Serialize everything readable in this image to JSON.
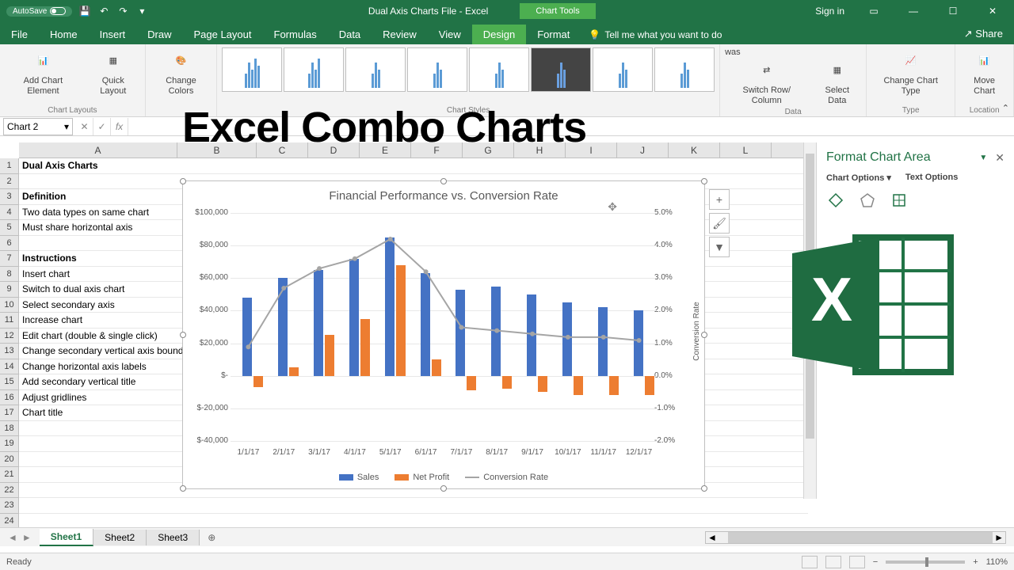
{
  "titlebar": {
    "autosave": "AutoSave",
    "filename": "Dual Axis Charts File - Excel",
    "chart_tools": "Chart Tools",
    "signin": "Sign in"
  },
  "tabs": {
    "file": "File",
    "home": "Home",
    "insert": "Insert",
    "draw": "Draw",
    "page_layout": "Page Layout",
    "formulas": "Formulas",
    "data": "Data",
    "review": "Review",
    "view": "View",
    "design": "Design",
    "format": "Format",
    "tell_me": "Tell me what you want to do",
    "share": "Share"
  },
  "ribbon": {
    "add_chart_element": "Add Chart Element",
    "quick_layout": "Quick Layout",
    "change_colors": "Change Colors",
    "chart_layouts": "Chart Layouts",
    "chart_styles": "Chart Styles",
    "switch_row_col": "Switch Row/ Column",
    "select_data": "Select Data",
    "data_group": "Data",
    "change_chart_type": "Change Chart Type",
    "type_group": "Type",
    "move_chart": "Move Chart",
    "location_group": "Location"
  },
  "overlay_title": "Excel Combo Charts",
  "name_box": "Chart 2",
  "columns": [
    "A",
    "B",
    "C",
    "D",
    "E",
    "F",
    "G",
    "H",
    "I",
    "J",
    "K",
    "L"
  ],
  "rows": [
    "1",
    "2",
    "3",
    "4",
    "5",
    "6",
    "7",
    "8",
    "9",
    "10",
    "11",
    "12",
    "13",
    "14",
    "15",
    "16",
    "17",
    "18",
    "19",
    "20",
    "21",
    "22",
    "23",
    "24"
  ],
  "cells": {
    "r1": "Dual Axis Charts",
    "r3": "Definition",
    "r4": "Two data types on same chart",
    "r5": "Must share horizontal axis",
    "r7": "Instructions",
    "r8": "Insert chart",
    "r9": "Switch to dual axis chart",
    "r10": "Select secondary axis",
    "r11": "Increase chart",
    "r12": "Edit chart (double & single click)",
    "r13": "Change secondary vertical axis bounds",
    "r14": "Change horizontal axis labels",
    "r15": "Add secondary vertical title",
    "r16": "Adjust gridlines",
    "r17": "Chart title"
  },
  "chart": {
    "title": "Financial Performance vs. Conversion Rate",
    "y_left": [
      "$100,000",
      "$80,000",
      "$60,000",
      "$40,000",
      "$20,000",
      "$-",
      "$-20,000",
      "$-40,000"
    ],
    "y_right": [
      "5.0%",
      "4.0%",
      "3.0%",
      "2.0%",
      "1.0%",
      "0.0%",
      "-1.0%",
      "-2.0%"
    ],
    "x": [
      "1/1/17",
      "2/1/17",
      "3/1/17",
      "4/1/17",
      "5/1/17",
      "6/1/17",
      "7/1/17",
      "8/1/17",
      "9/1/17",
      "10/1/17",
      "11/1/17",
      "12/1/17"
    ],
    "sec_title": "Conversion Rate",
    "legend": {
      "sales": "Sales",
      "profit": "Net Profit",
      "conv": "Conversion Rate"
    }
  },
  "chart_data": {
    "type": "bar",
    "title": "Financial Performance vs. Conversion Rate",
    "xlabel": "",
    "ylabel": "",
    "y2label": "Conversion Rate",
    "ylim": [
      -40000,
      100000
    ],
    "y2lim": [
      -2.0,
      5.0
    ],
    "categories": [
      "1/1/17",
      "2/1/17",
      "3/1/17",
      "4/1/17",
      "5/1/17",
      "6/1/17",
      "7/1/17",
      "8/1/17",
      "9/1/17",
      "10/1/17",
      "11/1/17",
      "12/1/17"
    ],
    "series": [
      {
        "name": "Sales",
        "type": "bar",
        "axis": "primary",
        "values": [
          48000,
          60000,
          65000,
          72000,
          85000,
          63000,
          53000,
          55000,
          50000,
          45000,
          42000,
          40000
        ]
      },
      {
        "name": "Net Profit",
        "type": "bar",
        "axis": "primary",
        "values": [
          -7000,
          5000,
          25000,
          35000,
          68000,
          10000,
          -9000,
          -8000,
          -10000,
          -12000,
          -12000,
          -12000
        ]
      },
      {
        "name": "Conversion Rate",
        "type": "line",
        "axis": "secondary",
        "values": [
          0.9,
          2.7,
          3.3,
          3.6,
          4.2,
          3.2,
          1.5,
          1.4,
          1.3,
          1.2,
          1.2,
          1.1
        ]
      }
    ]
  },
  "format_pane": {
    "title": "Format Chart Area",
    "chart_options": "Chart Options",
    "text_options": "Text Options"
  },
  "sheets": {
    "s1": "Sheet1",
    "s2": "Sheet2",
    "s3": "Sheet3"
  },
  "status": {
    "ready": "Ready",
    "zoom": "110%"
  }
}
